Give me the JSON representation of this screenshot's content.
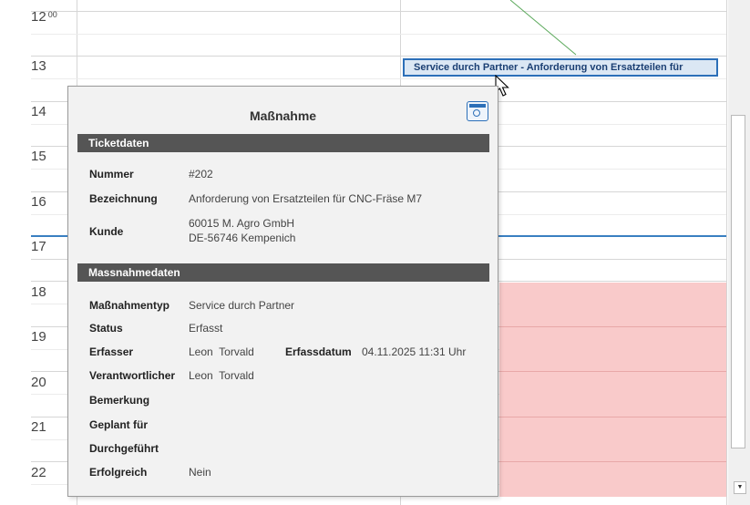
{
  "calendar": {
    "hours": [
      {
        "hour": "12",
        "minutes": "00"
      },
      {
        "hour": "13"
      },
      {
        "hour": "14"
      },
      {
        "hour": "15"
      },
      {
        "hour": "16"
      },
      {
        "hour": "17"
      },
      {
        "hour": "18"
      },
      {
        "hour": "19"
      },
      {
        "hour": "20"
      },
      {
        "hour": "21"
      },
      {
        "hour": "22"
      }
    ],
    "appointment": {
      "label": "Service durch Partner - Anforderung von Ersatzteilen für"
    },
    "colors": {
      "appointment_border": "#2c6fb8",
      "appointment_bg": "#dbe7f4",
      "blocked_time": "#f9caca",
      "now_line": "#3a7fc1"
    }
  },
  "popup": {
    "title": "Maßnahme",
    "icon": "calendar-bulb-icon",
    "sections": {
      "ticket": "Ticketdaten",
      "measure": "Massnahmedaten"
    },
    "ticket": {
      "nummer_label": "Nummer",
      "nummer_value": "#202",
      "bezeichnung_label": "Bezeichnung",
      "bezeichnung_value": "Anforderung von Ersatzteilen für CNC-Fräse M7",
      "kunde_label": "Kunde",
      "kunde_line1": "60015 M. Agro GmbH",
      "kunde_line2": "DE-56746 Kempenich"
    },
    "measure": {
      "typ_label": "Maßnahmentyp",
      "typ_value": "Service durch Partner",
      "status_label": "Status",
      "status_value": "Erfasst",
      "erfasser_label": "Erfasser",
      "erfasser_value": "Leon  Torvald",
      "erfassdatum_label": "Erfassdatum",
      "erfassdatum_value": "04.11.2025 11:31 Uhr",
      "verantwortlich_label": "Verantwortlicher",
      "verantwortlich_value": "Leon  Torvald",
      "bemerkung_label": "Bemerkung",
      "geplant_label": "Geplant für",
      "durchgefuehrt_label": "Durchgeführt",
      "erfolgreich_label": "Erfolgreich",
      "erfolgreich_value": "Nein"
    }
  }
}
